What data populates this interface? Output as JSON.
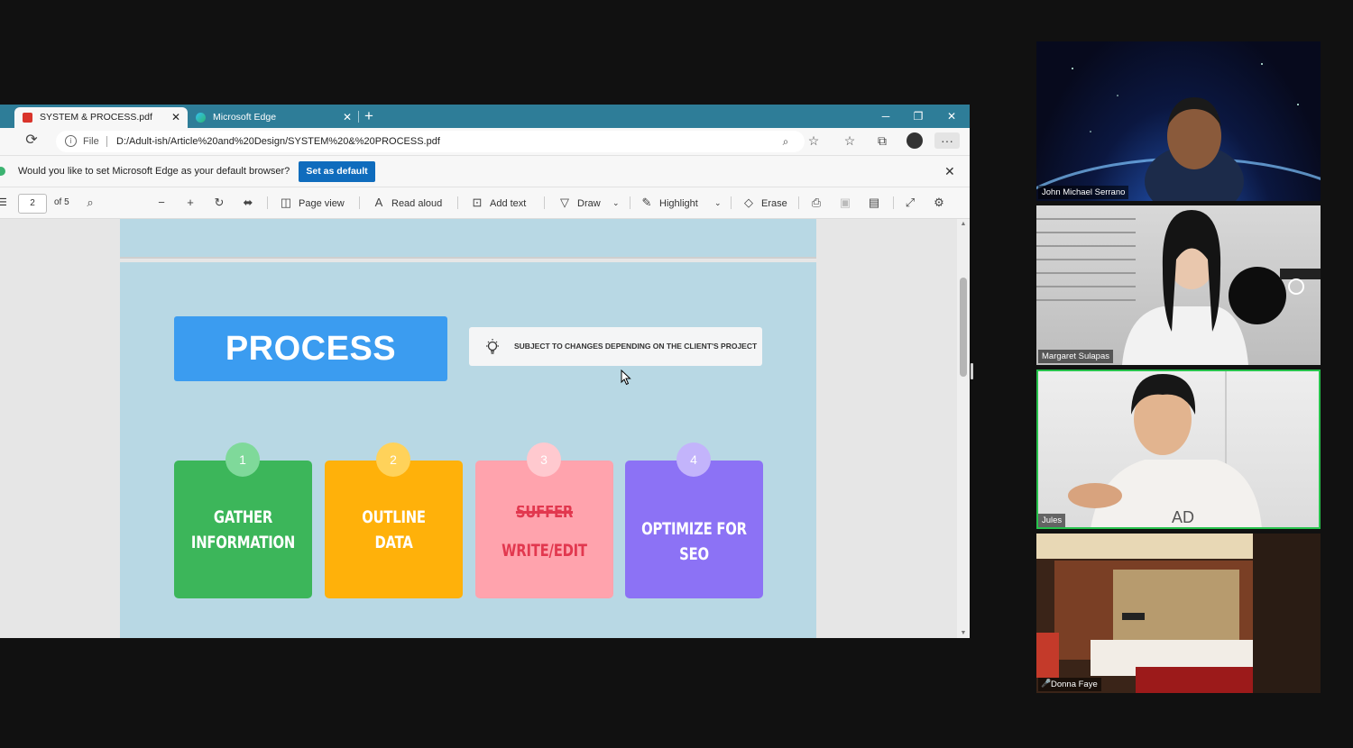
{
  "browser": {
    "tabs": [
      {
        "label": "SYSTEM & PROCESS.pdf",
        "active": true
      },
      {
        "label": "Microsoft Edge",
        "active": false
      }
    ],
    "address": {
      "file_label": "File",
      "url": "D:/Adult-ish/Article%20and%20Design/SYSTEM%20&%20PROCESS.pdf"
    },
    "notification": {
      "message": "Would you like to set Microsoft Edge as your default browser?",
      "button": "Set as default"
    }
  },
  "pdf_toolbar": {
    "page_number": "2",
    "page_of": "of 5",
    "page_view": "Page view",
    "read_aloud": "Read aloud",
    "add_text": "Add text",
    "draw": "Draw",
    "highlight": "Highlight",
    "erase": "Erase"
  },
  "slide": {
    "title": "PROCESS",
    "note": "SUBJECT TO CHANGES DEPENDING ON THE CLIENT'S PROJECT",
    "steps": [
      {
        "num": "1",
        "line1": "GATHER",
        "line2": "INFORMATION",
        "color": "#3cb65a",
        "badge": "#7fd99a"
      },
      {
        "num": "2",
        "line1": "OUTLINE",
        "line2": "DATA",
        "color": "#ffb10a",
        "badge": "#ffd25a"
      },
      {
        "num": "3",
        "struck": "SUFFER",
        "line2": "WRITE/EDIT",
        "color": "#ffa3ad",
        "badge": "#ffc9cf",
        "text_color": "#e2384f"
      },
      {
        "num": "4",
        "line1": "OPTIMIZE FOR SEO",
        "color": "#8c72f5",
        "badge": "#c3b4fb"
      }
    ]
  },
  "participants": [
    {
      "name": "John Michael Serrano"
    },
    {
      "name": "Margaret Sulapas"
    },
    {
      "name": "Jules"
    },
    {
      "name": "Donna Faye"
    }
  ],
  "colors": {
    "tabbar": "#2e7d98",
    "accent": "#0f6cbd",
    "slide_bg": "#b8d8e4",
    "process": "#3b9cf0",
    "active_speaker": "#27c24c"
  }
}
